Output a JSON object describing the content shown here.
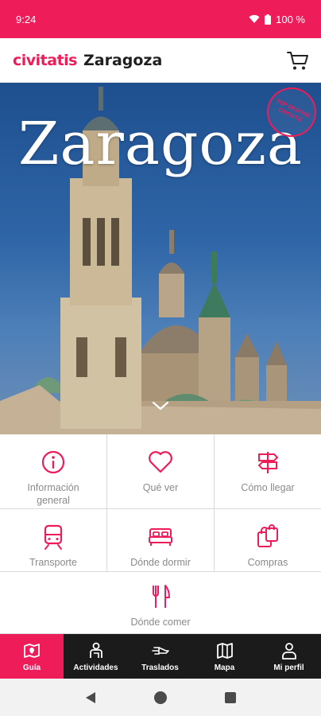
{
  "status_bar": {
    "time": "9:24",
    "battery": "100 %"
  },
  "header": {
    "brand": "civitatis",
    "city": "Zaragoza"
  },
  "hero": {
    "title": "Zaragoza",
    "badge": "TOP DESTINE CIVITATIS"
  },
  "grid": {
    "items": [
      {
        "label": "Información general",
        "icon": "info-icon"
      },
      {
        "label": "Qué ver",
        "icon": "heart-icon"
      },
      {
        "label": "Cómo llegar",
        "icon": "signpost-icon"
      },
      {
        "label": "Transporte",
        "icon": "train-icon"
      },
      {
        "label": "Dónde dormir",
        "icon": "bed-icon"
      },
      {
        "label": "Compras",
        "icon": "shopping-bags-icon"
      },
      {
        "label": "Dónde comer",
        "icon": "fork-knife-icon"
      }
    ]
  },
  "bottom_nav": {
    "items": [
      {
        "label": "Guía",
        "icon": "map-book-icon",
        "active": true
      },
      {
        "label": "Actividades",
        "icon": "person-icon"
      },
      {
        "label": "Traslados",
        "icon": "transfer-icon"
      },
      {
        "label": "Mapa",
        "icon": "map-icon"
      },
      {
        "label": "Mi perfil",
        "icon": "profile-icon"
      }
    ]
  },
  "colors": {
    "accent": "#ef1c5a",
    "nav_bg": "#1b1b1b",
    "text_gray": "#8a8a8a"
  }
}
